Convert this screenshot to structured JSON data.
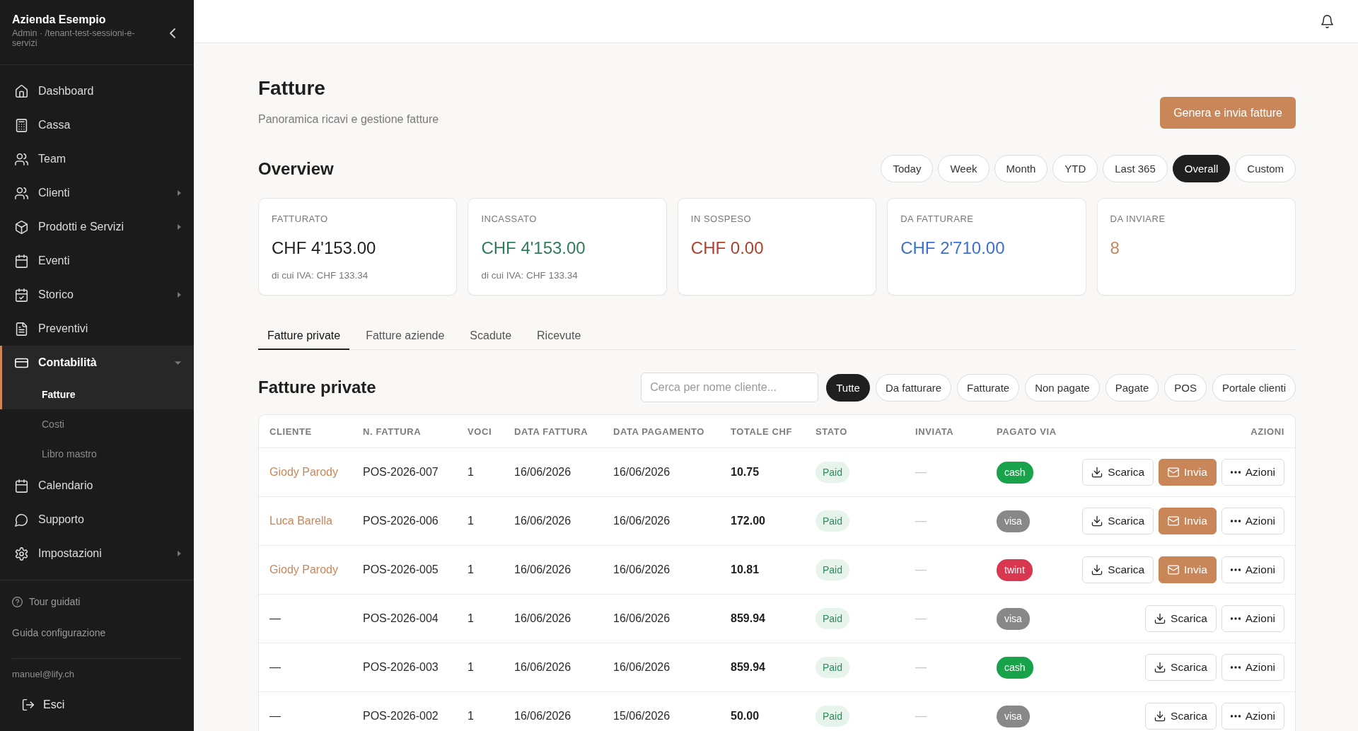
{
  "sidebar": {
    "company": "Azienda Esempio",
    "subtitle": "Admin · /tenant-test-sessioni-e-servizi",
    "items": [
      {
        "label": "Dashboard",
        "selected": false
      },
      {
        "label": "Cassa",
        "selected": false
      },
      {
        "label": "Team",
        "selected": false
      },
      {
        "label": "Clienti",
        "selected": false,
        "expanded": false
      },
      {
        "label": "Prodotti e Servizi",
        "selected": false,
        "expanded": false
      },
      {
        "label": "Eventi",
        "selected": false
      },
      {
        "label": "Storico",
        "selected": false,
        "expanded": false
      },
      {
        "label": "Preventivi",
        "selected": false
      },
      {
        "label": "Contabilità",
        "selected": true,
        "expanded": true,
        "children": [
          {
            "label": "Fatture",
            "selected": true
          },
          {
            "label": "Costi",
            "selected": false
          },
          {
            "label": "Libro mastro",
            "selected": false
          }
        ]
      },
      {
        "label": "Calendario",
        "selected": false
      },
      {
        "label": "Supporto",
        "selected": false
      },
      {
        "label": "Impostazioni",
        "selected": false,
        "expanded": false
      }
    ],
    "help_links": [
      {
        "kind": "tour",
        "label": "Tour guidati"
      },
      {
        "kind": "guide",
        "label": "Guida configurazione"
      }
    ],
    "user_email": "manuel@lify.ch",
    "logout": "Esci"
  },
  "page": {
    "title": "Fatture",
    "subtitle": "Panoramica ricavi e gestione fatture",
    "primary_action": "Genera e invia fatture"
  },
  "overview": {
    "title": "Overview",
    "periods": [
      {
        "label": "Today",
        "selected": false
      },
      {
        "label": "Week",
        "selected": false
      },
      {
        "label": "Month",
        "selected": false
      },
      {
        "label": "YTD",
        "selected": false
      },
      {
        "label": "Last 365",
        "selected": false
      },
      {
        "label": "Overall",
        "selected": true
      },
      {
        "label": "Custom",
        "selected": false
      }
    ],
    "cards": [
      {
        "label": "FATTURATO",
        "value": "CHF 4'153.00",
        "color": "#1f1f1f",
        "note": "di cui IVA: CHF 133.34"
      },
      {
        "label": "INCASSATO",
        "value": "CHF 4'153.00",
        "color": "#2e7d57",
        "note": "di cui IVA: CHF 133.34"
      },
      {
        "label": "IN SOSPESO",
        "value": "CHF 0.00",
        "color": "#b0402c"
      },
      {
        "label": "DA FATTURARE",
        "value": "CHF 2'710.00",
        "color": "#3b6fd6"
      },
      {
        "label": "DA INVIARE",
        "value": "8",
        "color": "#c98659"
      }
    ]
  },
  "tabs": [
    {
      "label": "Fatture private",
      "selected": true
    },
    {
      "label": "Fatture aziende",
      "selected": false
    },
    {
      "label": "Scadute",
      "selected": false
    },
    {
      "label": "Ricevute",
      "selected": false
    }
  ],
  "invoices": {
    "title": "Fatture private",
    "search": {
      "placeholder": "Cerca per nome cliente..."
    },
    "filters": [
      {
        "label": "Tutte",
        "selected": true
      },
      {
        "label": "Da fatturare",
        "selected": false
      },
      {
        "label": "Fatturate",
        "selected": false
      },
      {
        "label": "Non pagate",
        "selected": false
      },
      {
        "label": "Pagate",
        "selected": false
      },
      {
        "label": "POS",
        "selected": false
      },
      {
        "label": "Portale clienti",
        "selected": false
      }
    ],
    "columns": [
      "CLIENTE",
      "N. FATTURA",
      "VOCI",
      "DATA FATTURA",
      "DATA PAGAMENTO",
      "TOTALE CHF",
      "STATO",
      "INVIATA",
      "PAGATO VIA",
      "AZIONI"
    ],
    "rows": [
      {
        "client": "Giody Parody",
        "linked": true,
        "number": "POS-2026-007",
        "items": "1",
        "invoice_date": "16/06/2026",
        "payment_date": "16/06/2026",
        "total": "10.75",
        "status": "Paid",
        "sent": "—",
        "paid_via": {
          "label": "cash",
          "color": "#18a34a"
        },
        "actions": [
          {
            "kind": "download",
            "label": "Scarica"
          },
          {
            "kind": "send",
            "label": "Invia"
          },
          {
            "kind": "more",
            "label": "Azioni"
          }
        ]
      },
      {
        "client": "Luca Barella",
        "linked": true,
        "number": "POS-2026-006",
        "items": "1",
        "invoice_date": "16/06/2026",
        "payment_date": "16/06/2026",
        "total": "172.00",
        "status": "Paid",
        "sent": "—",
        "paid_via": {
          "label": "visa",
          "color": "#888888"
        },
        "actions": [
          {
            "kind": "download",
            "label": "Scarica"
          },
          {
            "kind": "send",
            "label": "Invia"
          },
          {
            "kind": "more",
            "label": "Azioni"
          }
        ]
      },
      {
        "client": "Giody Parody",
        "linked": true,
        "number": "POS-2026-005",
        "items": "1",
        "invoice_date": "16/06/2026",
        "payment_date": "16/06/2026",
        "total": "10.81",
        "status": "Paid",
        "sent": "—",
        "paid_via": {
          "label": "twint",
          "color": "#d9364f"
        },
        "actions": [
          {
            "kind": "download",
            "label": "Scarica"
          },
          {
            "kind": "send",
            "label": "Invia"
          },
          {
            "kind": "more",
            "label": "Azioni"
          }
        ]
      },
      {
        "client": "—",
        "linked": false,
        "number": "POS-2026-004",
        "items": "1",
        "invoice_date": "16/06/2026",
        "payment_date": "16/06/2026",
        "total": "859.94",
        "status": "Paid",
        "sent": "—",
        "paid_via": {
          "label": "visa",
          "color": "#888888"
        },
        "actions": [
          {
            "kind": "download",
            "label": "Scarica"
          },
          {
            "kind": "more",
            "label": "Azioni"
          }
        ]
      },
      {
        "client": "—",
        "linked": false,
        "number": "POS-2026-003",
        "items": "1",
        "invoice_date": "16/06/2026",
        "payment_date": "16/06/2026",
        "total": "859.94",
        "status": "Paid",
        "sent": "—",
        "paid_via": {
          "label": "cash",
          "color": "#18a34a"
        },
        "actions": [
          {
            "kind": "download",
            "label": "Scarica"
          },
          {
            "kind": "more",
            "label": "Azioni"
          }
        ]
      },
      {
        "client": "—",
        "linked": false,
        "number": "POS-2026-002",
        "items": "1",
        "invoice_date": "16/06/2026",
        "payment_date": "15/06/2026",
        "total": "50.00",
        "status": "Paid",
        "sent": "—",
        "paid_via": {
          "label": "visa",
          "color": "#888888"
        },
        "actions": [
          {
            "kind": "download",
            "label": "Scarica"
          },
          {
            "kind": "more",
            "label": "Azioni"
          }
        ]
      }
    ]
  }
}
